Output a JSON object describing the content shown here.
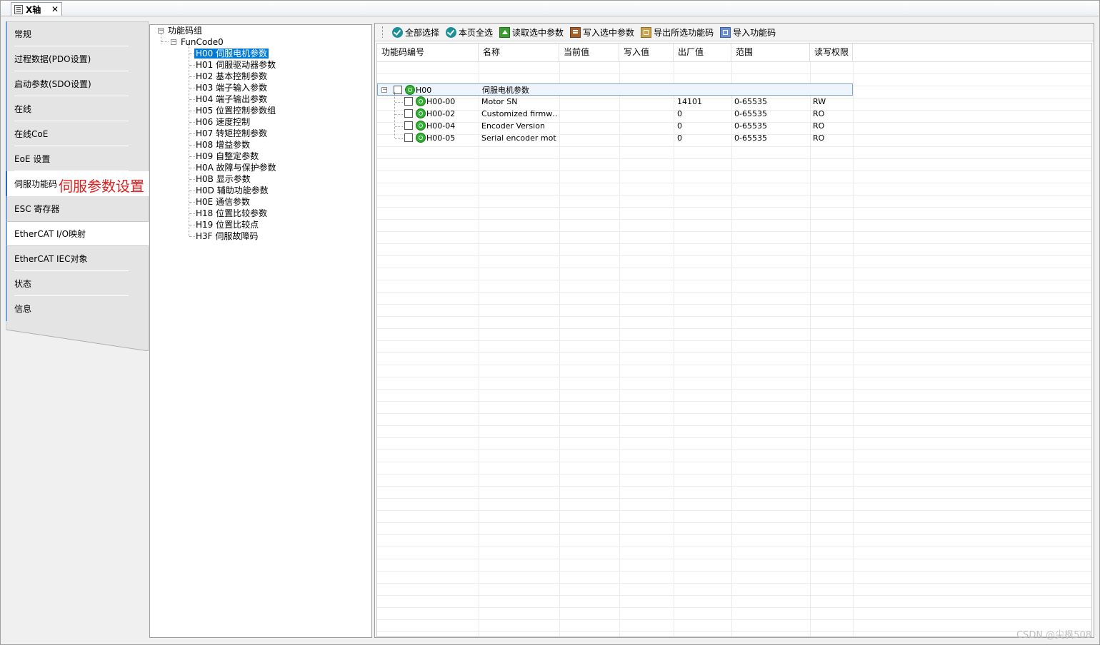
{
  "tab": {
    "title": "X轴",
    "close": "✕"
  },
  "nav": {
    "items": [
      "常规",
      "过程数据(PDO设置)",
      "启动参数(SDO设置)",
      "在线",
      "在线CoE",
      "EoE 设置",
      "伺服功能码",
      "ESC 寄存器",
      "EtherCAT I/O映射",
      "EtherCAT IEC对象",
      "状态",
      "信息"
    ],
    "annotation": "伺服参数设置"
  },
  "tree": {
    "root": "功能码组",
    "child": "FunCode0",
    "items": [
      "H00 伺服电机参数",
      "H01 伺服驱动器参数",
      "H02 基本控制参数",
      "H03 端子输入参数",
      "H04 端子输出参数",
      "H05 位置控制参数组",
      "H06 速度控制",
      "H07 转矩控制参数",
      "H08 增益参数",
      "H09 自整定参数",
      "H0A 故障与保护参数",
      "H0B 显示参数",
      "H0D 辅助功能参数",
      "H0E 通信参数",
      "H18 位置比较参数",
      "H19 位置比较点",
      "H3F 伺服故障码"
    ]
  },
  "toolbar": {
    "select_all": "全部选择",
    "page_select_all": "本页全选",
    "read_selected": "读取选中参数",
    "write_selected": "写入选中参数",
    "export_selected": "导出所选功能码",
    "import": "导入功能码"
  },
  "grid": {
    "headers": [
      "功能码编号",
      "名称",
      "当前值",
      "写入值",
      "出厂值",
      "范围",
      "读写权限"
    ],
    "group": {
      "code": "H00",
      "name": "伺服电机参数"
    },
    "rows": [
      {
        "code": "H00-00",
        "name": "Motor SN",
        "current": "",
        "write": "",
        "default": "14101",
        "range": "0-65535",
        "access": "RW"
      },
      {
        "code": "H00-02",
        "name": "Customized firmw…",
        "current": "",
        "write": "",
        "default": "0",
        "range": "0-65535",
        "access": "RO"
      },
      {
        "code": "H00-04",
        "name": "Encoder Version",
        "current": "",
        "write": "",
        "default": "0",
        "range": "0-65535",
        "access": "RO"
      },
      {
        "code": "H00-05",
        "name": "Serial encoder mot…",
        "current": "",
        "write": "",
        "default": "0",
        "range": "0-65535",
        "access": "RO"
      }
    ]
  },
  "watermark": "CSDN @尖枫508"
}
